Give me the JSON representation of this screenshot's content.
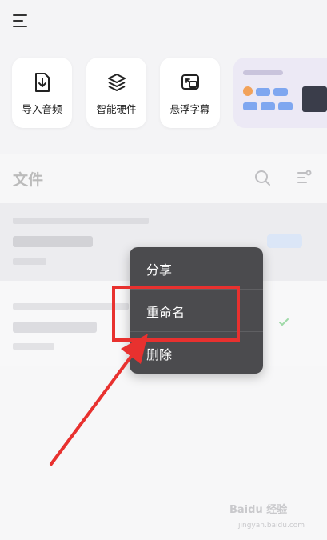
{
  "toolbar": {
    "menu_icon": "hamburger-menu-icon"
  },
  "quick_tools": [
    {
      "label": "导入音频",
      "icon": "import-audio-icon"
    },
    {
      "label": "智能硬件",
      "icon": "layers-icon"
    },
    {
      "label": "悬浮字幕",
      "icon": "floating-subtitle-icon"
    }
  ],
  "section": {
    "title": "文件"
  },
  "context_menu": {
    "items": [
      {
        "label": "分享"
      },
      {
        "label": "重命名"
      },
      {
        "label": "删除"
      }
    ]
  },
  "colors": {
    "menu_bg": "#4b4b4e",
    "annotation": "#e8312f",
    "page_bg": "#f4f4f6"
  },
  "watermark": {
    "text": "Baidu 经验",
    "sub": "jingyan.baidu.com"
  }
}
